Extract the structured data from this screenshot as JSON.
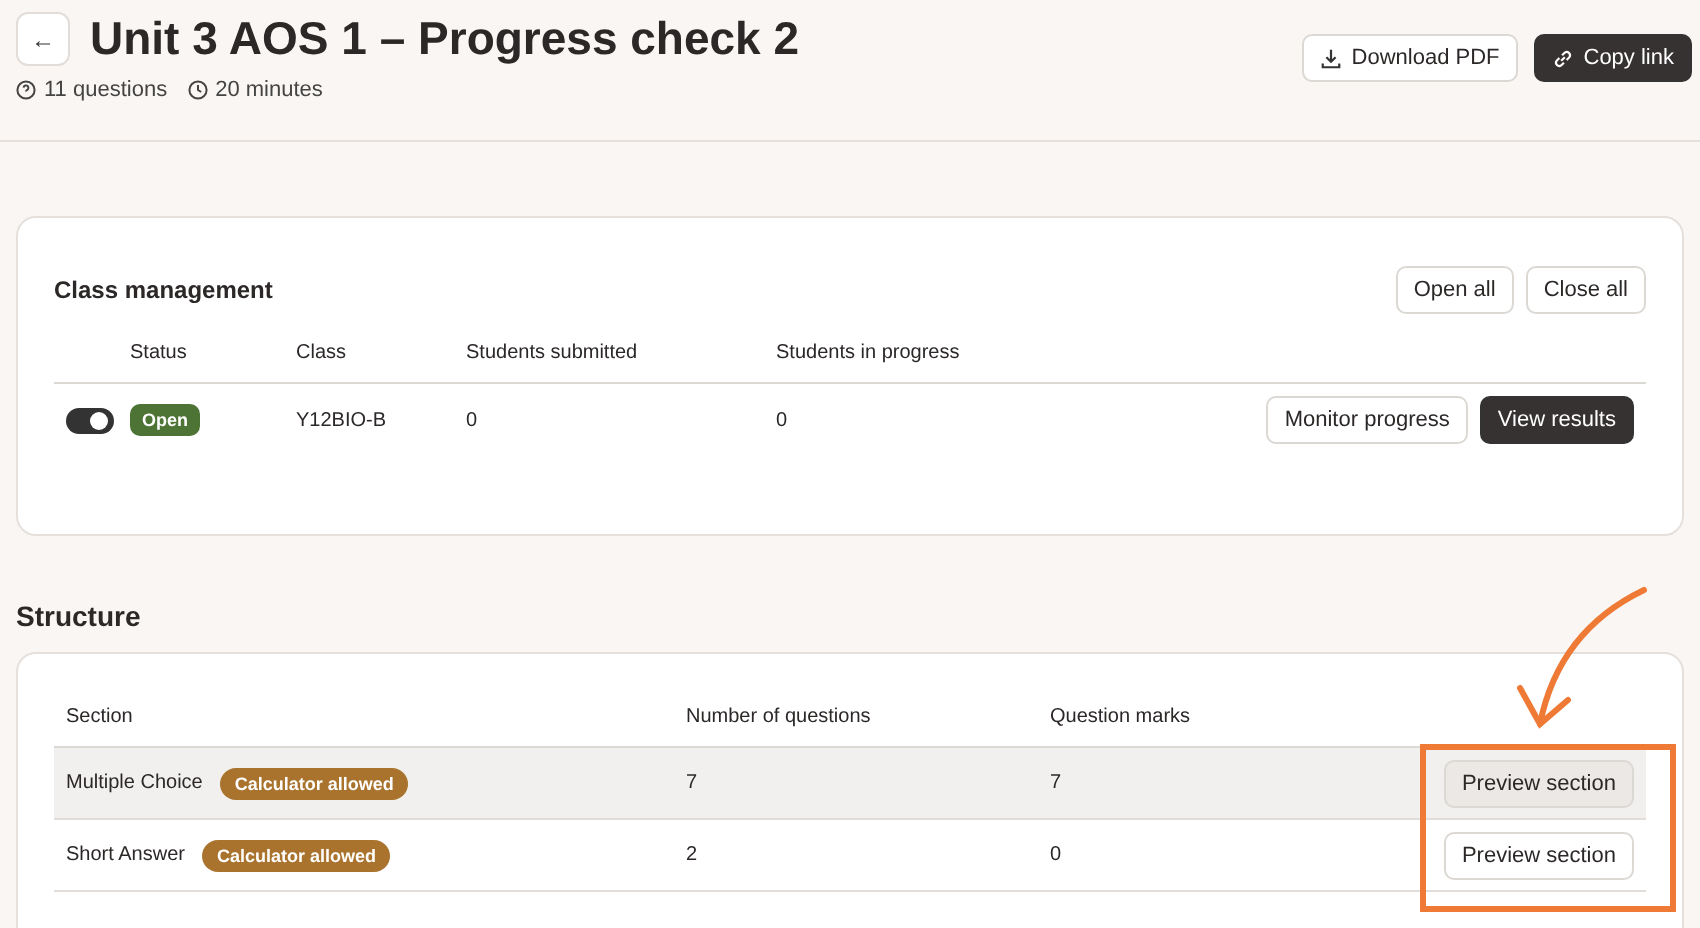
{
  "header": {
    "back": "←",
    "title": "Unit 3 AOS 1 – Progress check 2",
    "meta": [
      "11 questions",
      "20 minutes"
    ],
    "actions": [
      {
        "label": "Download PDF",
        "kind": "download"
      },
      {
        "label": "Copy link",
        "kind": "link"
      }
    ]
  },
  "class_management": {
    "title": "Class management",
    "actions": [
      "Open all",
      "Close all"
    ],
    "columns": [
      "Status",
      "Class",
      "Students submitted",
      "Students in progress"
    ],
    "rows": [
      {
        "on": true,
        "status": "Open",
        "class": "Y12BIO-B",
        "submitted": "0",
        "in_progress": "0",
        "actions": [
          {
            "label": "Monitor progress",
            "kind": "secondary"
          },
          {
            "label": "View results",
            "kind": "primary"
          }
        ]
      }
    ]
  },
  "structure": {
    "title": "Structure",
    "columns": [
      "Section",
      "Number of questions",
      "Question marks"
    ],
    "rows": [
      {
        "section": "Multiple Choice",
        "tag": "Calculator allowed",
        "questions": "7",
        "marks": "7",
        "action": "Preview section",
        "hovered": true
      },
      {
        "section": "Short Answer",
        "tag": "Calculator allowed",
        "questions": "2",
        "marks": "0",
        "action": "Preview section",
        "hovered": false
      }
    ]
  },
  "annotation": {
    "kind": "arrow-box"
  }
}
